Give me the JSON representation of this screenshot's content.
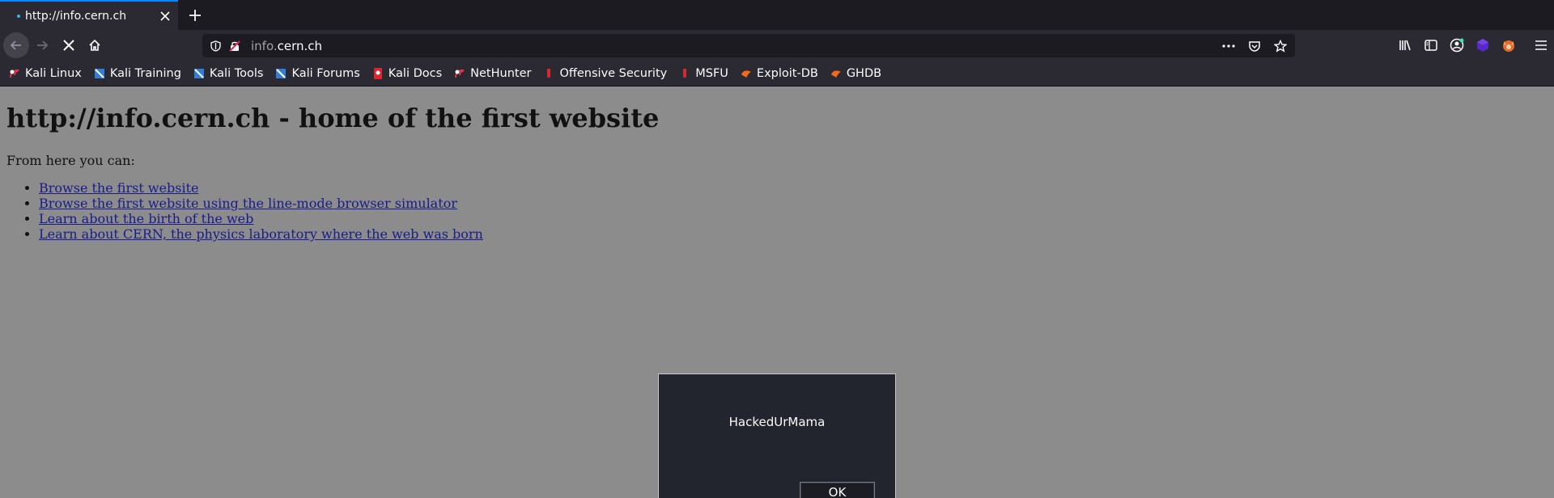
{
  "browser": {
    "tab_title": "http://info.cern.ch",
    "url_subdomain": "info.",
    "url_domain": "cern.ch",
    "accent_color": "#0a84ff",
    "chrome_color": "#2b2a33"
  },
  "bookmarks": [
    {
      "label": "Kali Linux",
      "icon": "kali-dragon-icon"
    },
    {
      "label": "Kali Training",
      "icon": "kali-training-icon"
    },
    {
      "label": "Kali Tools",
      "icon": "kali-tools-icon"
    },
    {
      "label": "Kali Forums",
      "icon": "kali-forums-icon"
    },
    {
      "label": "Kali Docs",
      "icon": "kali-docs-icon"
    },
    {
      "label": "NetHunter",
      "icon": "nethunter-icon"
    },
    {
      "label": "Offensive Security",
      "icon": "offsec-icon"
    },
    {
      "label": "MSFU",
      "icon": "msfu-icon"
    },
    {
      "label": "Exploit-DB",
      "icon": "exploitdb-icon"
    },
    {
      "label": "GHDB",
      "icon": "ghdb-icon"
    }
  ],
  "page": {
    "heading": "http://info.cern.ch - home of the first website",
    "intro": "From here you can:",
    "links": [
      "Browse the first website",
      "Browse the first website using the line-mode browser simulator",
      "Learn about the birth of the web",
      "Learn about CERN, the physics laboratory where the web was born"
    ]
  },
  "dialog": {
    "message": "HackedUrMama",
    "ok_label": "OK"
  }
}
